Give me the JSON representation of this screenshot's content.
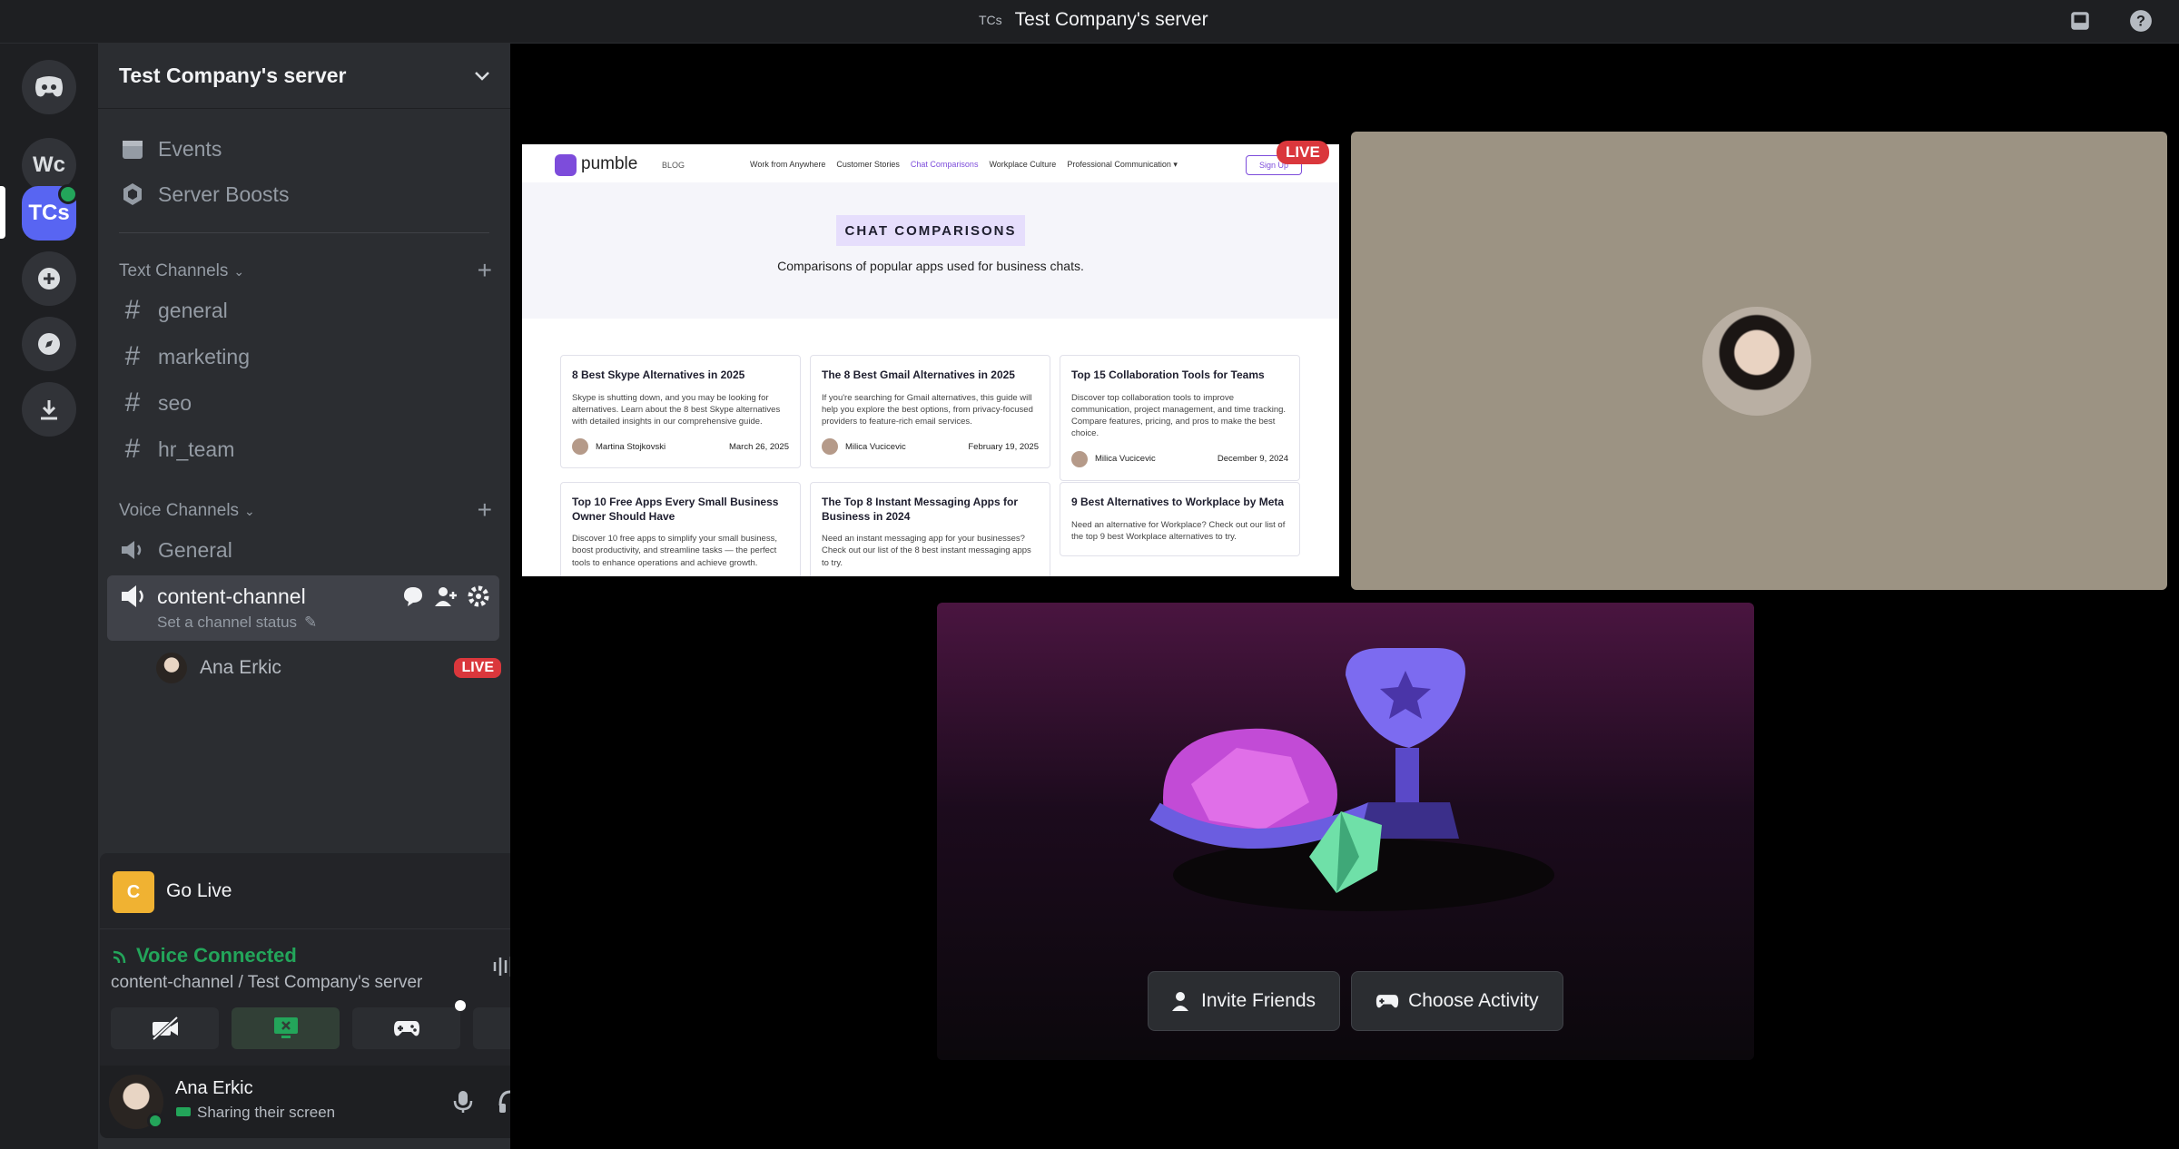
{
  "titlebar": {
    "icon_text": "TCs",
    "title": "Test Company's server"
  },
  "rail": {
    "servers": [
      {
        "label": "Wc"
      },
      {
        "label": "TCs"
      }
    ]
  },
  "server": {
    "name": "Test Company's server",
    "top_items": [
      {
        "label": "Events",
        "icon": "calendar-icon"
      },
      {
        "label": "Server Boosts",
        "icon": "boost-icon"
      }
    ],
    "text_category": "Text Channels",
    "text_channels": [
      "general",
      "marketing",
      "seo",
      "hr_team"
    ],
    "voice_category": "Voice Channels",
    "voice_channels": [
      "General",
      "content-channel"
    ],
    "active_channel": {
      "name": "content-channel",
      "status": "Set a channel status"
    },
    "member": {
      "name": "Ana Erkic",
      "badge": "LIVE"
    }
  },
  "panel": {
    "go_live": {
      "icon_text": "C",
      "label": "Go Live"
    },
    "voice": {
      "status": "Voice Connected",
      "location": "content-channel / Test Company's server"
    },
    "user": {
      "name": "Ana Erkic",
      "status": "Sharing their screen"
    }
  },
  "stream": {
    "live_badge": "LIVE",
    "brand": "pumble",
    "blog": "BLOG",
    "nav_links": [
      "Work from Anywhere",
      "Customer Stories",
      "Chat Comparisons",
      "Workplace Culture",
      "Professional Communication ▾"
    ],
    "signup": "Sign Up",
    "badge": "CHAT COMPARISONS",
    "subtitle": "Comparisons of popular apps used for business chats.",
    "cards": [
      {
        "title": "8 Best Skype Alternatives in 2025",
        "desc": "Skype is shutting down, and you may be looking for alternatives. Learn about the 8 best Skype alternatives with detailed insights in our comprehensive guide.",
        "author": "Martina Stojkovski",
        "date": "March 26, 2025"
      },
      {
        "title": "The 8 Best Gmail Alternatives in 2025",
        "desc": "If you're searching for Gmail alternatives, this guide will help you explore the best options, from privacy-focused providers to feature-rich email services.",
        "author": "Milica Vucicevic",
        "date": "February 19, 2025"
      },
      {
        "title": "Top 15 Collaboration Tools for Teams",
        "desc": "Discover top collaboration tools to improve communication, project management, and time tracking. Compare features, pricing, and pros to make the best choice.",
        "author": "Milica Vucicevic",
        "date": "December 9, 2024"
      },
      {
        "title": "Top 10 Free Apps Every Small Business Owner Should Have",
        "desc": "Discover 10 free apps to simplify your small business, boost productivity, and streamline tasks — the perfect tools to enhance operations and achieve growth."
      },
      {
        "title": "The Top 8 Instant Messaging Apps for Business in 2024",
        "desc": "Need an instant messaging app for your businesses? Check out our list of the 8 best instant messaging apps to try."
      },
      {
        "title": "9 Best Alternatives to Workplace by Meta",
        "desc": "Need an alternative for Workplace? Check out our list of the top 9 best Workplace alternatives to try."
      }
    ]
  },
  "activity": {
    "invite_label": "Invite Friends",
    "choose_label": "Choose Activity"
  },
  "colors": {
    "accent": "#5865f2",
    "live": "#da373c",
    "connected": "#23a55a"
  }
}
